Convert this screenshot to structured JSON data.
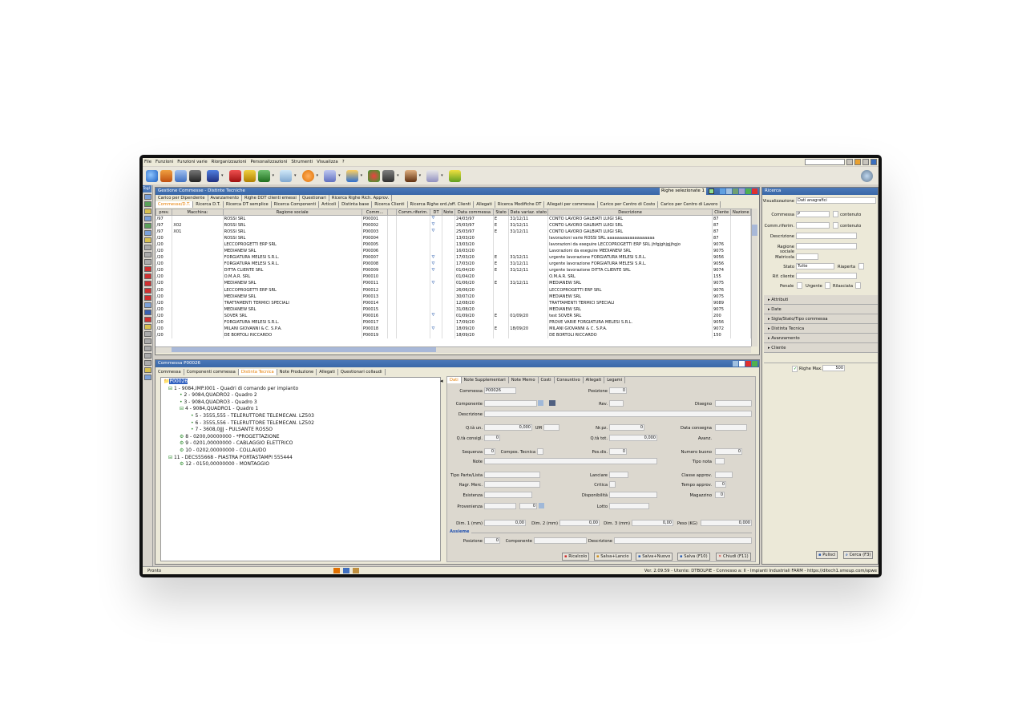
{
  "menu": [
    "File",
    "Funzioni",
    "Funzioni varie",
    "Riorganizzazioni",
    "Personalizzazioni",
    "Strumenti",
    "Visualizza",
    "?"
  ],
  "left_top_tab": "Togl",
  "main": {
    "title": "Gestione Commesse - Distinte Tecniche",
    "selected_label": "Righe selezionate 1",
    "tabs_row1": [
      "Carico per Dipendente",
      "Avanzamento",
      "Righe DDT clienti emessi",
      "Questionari",
      "Ricerca Righe Rich. Approv."
    ],
    "tabs_row2": [
      "Commesse/D.T.",
      "Ricerca D.T.",
      "Ricerca DT semplice",
      "Ricerca Componenti",
      "Articoli",
      "Distinta base",
      "Ricerca Clienti",
      "Ricerca Righe ord./off. Clienti",
      "Allegati",
      "Ricerca Modifiche DT",
      "Allegati per commessa",
      "Carico per Centro di Costo",
      "Carico per Centro di Lavoro"
    ],
    "columns": [
      "prev.",
      "Macchina:",
      "Ragione sociale",
      "Comm...",
      "",
      "Comm.riferim.",
      "DT",
      "Note",
      "Data commessa",
      "Stato",
      "Data variaz. stato",
      "Descrizione",
      "Cliente",
      "Nazione"
    ],
    "rows": [
      [
        "/97",
        "",
        "ROSSI SRL",
        "P00001",
        "",
        "",
        "",
        "",
        "24/03/97",
        "E",
        "31/12/11",
        "CONTO LAVORO GALBIATI LUIGI SRL",
        "87",
        ""
      ],
      [
        "/97",
        "X02",
        "ROSSI SRL",
        "P00002",
        "",
        "",
        "",
        "",
        "25/03/97",
        "E",
        "31/12/11",
        "CONTO LAVORO GALBIATI LUIGI SRL",
        "87",
        ""
      ],
      [
        "/97",
        "X01",
        "ROSSI SRL",
        "P00003",
        "",
        "",
        "",
        "",
        "25/03/97",
        "E",
        "31/12/11",
        "CONTO LAVORO GALBIATI LUIGI SRL",
        "87",
        ""
      ],
      [
        "/20",
        "",
        "ROSSI SRL",
        "P00004",
        "",
        "",
        "",
        "",
        "13/03/20",
        "",
        "",
        "lavorazioni varie ROSSI SRL aaaaaaaaaaaaaaaaaaa",
        "87",
        ""
      ],
      [
        "/20",
        "",
        "LECCOPROGETTI ERP SRL",
        "P00005",
        "",
        "",
        "",
        "",
        "13/03/20",
        "",
        "",
        "lavorazioni da eseguire LECCOPROGETTI ERP SRL jhfgjghjgjjhgjo",
        "9076",
        ""
      ],
      [
        "/20",
        "",
        "MEDIANEW SRL",
        "P00006",
        "",
        "",
        "",
        "",
        "16/03/20",
        "",
        "",
        "Lavorazioni da eseguire MEDIANEW SRL",
        "9075",
        ""
      ],
      [
        "/20",
        "",
        "FORGIATURA MELESI S.R.L.",
        "P00007",
        "",
        "",
        "",
        "",
        "17/03/20",
        "E",
        "31/12/11",
        "urgente lavorazione FORGIATURA MELESI S.R.L.",
        "9056",
        ""
      ],
      [
        "/20",
        "",
        "FORGIATURA MELESI S.R.L.",
        "P00008",
        "",
        "",
        "",
        "",
        "17/03/20",
        "E",
        "31/12/11",
        "urgente lavorazione FORGIATURA MELESI S.R.L.",
        "9056",
        ""
      ],
      [
        "/20",
        "",
        "DITTA CLIENTE SRL",
        "P00009",
        "",
        "",
        "",
        "",
        "01/04/20",
        "E",
        "31/12/11",
        "urgente lavorazione DITTA CLIENTE SRL",
        "9074",
        ""
      ],
      [
        "/20",
        "",
        "O.M.A.R. SRL",
        "P00010",
        "",
        "",
        "",
        "",
        "01/04/20",
        "",
        "",
        "O.M.A.R. SRL",
        "155",
        ""
      ],
      [
        "/20",
        "",
        "MEDIANEW SRL",
        "P00011",
        "",
        "",
        "",
        "",
        "01/06/20",
        "E",
        "31/12/11",
        "MEDIANEW SRL",
        "9075",
        ""
      ],
      [
        "/20",
        "",
        "LECCOPROGETTI ERP SRL",
        "P00012",
        "",
        "",
        "",
        "",
        "26/06/20",
        "",
        "",
        "LECCOPROGETTI ERP SRL",
        "9076",
        ""
      ],
      [
        "/20",
        "",
        "MEDIANEW SRL",
        "P00013",
        "",
        "",
        "",
        "",
        "30/07/20",
        "",
        "",
        "MEDIANEW SRL",
        "9075",
        ""
      ],
      [
        "/20",
        "",
        "TRATTAMENTI TERMICI SPECIALI",
        "P00014",
        "",
        "",
        "",
        "",
        "12/08/20",
        "",
        "",
        "TRATTAMENTI TERMICI SPECIALI",
        "9089",
        ""
      ],
      [
        "/20",
        "",
        "MEDIANEW SRL",
        "P00015",
        "",
        "",
        "",
        "",
        "31/08/20",
        "",
        "",
        "MEDIANEW SRL",
        "9075",
        ""
      ],
      [
        "/20",
        "",
        "SOVER SRL",
        "P00016",
        "",
        "",
        "",
        "",
        "01/09/20",
        "E",
        "01/09/20",
        "test SOVER SRL",
        "200",
        ""
      ],
      [
        "/20",
        "",
        "FORGIATURA MELESI S.R.L.",
        "P00017",
        "",
        "",
        "",
        "",
        "17/09/20",
        "",
        "",
        "PROVE VARIE FORGIATURA MELESI S.R.L.",
        "9056",
        ""
      ],
      [
        "/20",
        "",
        "MILANI GIOVANNI & C. S.P.A.",
        "P00018",
        "",
        "",
        "",
        "",
        "18/09/20",
        "E",
        "18/09/20",
        "MILANI GIOVANNI & C. S.P.A.",
        "9072",
        ""
      ],
      [
        "/20",
        "",
        "DE BORTOLI RICCARDO",
        "P00019",
        "",
        "",
        "",
        "",
        "18/09/20",
        "",
        "",
        "DE BORTOLI RICCARDO",
        "150",
        ""
      ]
    ]
  },
  "detail": {
    "title": "Commessa P00026",
    "tabs": [
      "Commessa",
      "Componenti commessa",
      "Distinta Tecnica",
      "Note Produzione",
      "Allegati",
      "Questionari collaudi"
    ],
    "tree": [
      "P00026",
      "1 - 9084,IMP.I001 - Quadri di comando per impianto",
      "2 - 9084,QUADRO2 - Quadro 2",
      "3 - 9084,QUADRO3 - Quadro 3",
      "4 - 9084,QUADRO1 - Quadro 1",
      "5 - 3555,555 - TELERUTTORE TELEMECAN. LZ503",
      "6 - 3555,556 - TELERUTTORE TELEMECAN. LZ502",
      "7 - 3608,0JJJ - PULSANTE ROSSO",
      "8 - 0200,00000000 - *PROGETTAZIONE",
      "9 - 0201,00000000 - CABLAGGIO ELETTRICO",
      "10 - 0202,00000000 - COLLAUDO",
      "11 - DECS55668 - PIASTRA PORTASTAMPI 555444",
      "12 - 0150,00000000 - MONTAGGIO"
    ],
    "form_tabs": [
      "Dati",
      "Note Supplementari",
      "Note Memo",
      "Costi",
      "Consuntivo",
      "Allegati",
      "Legami"
    ],
    "labels": {
      "commessa": "Commessa",
      "posizione": "Posizione",
      "componente": "Componente",
      "rev": "Rev.",
      "disegno": "Disegno",
      "descrizione": "Descrizione",
      "qta_un": "Q.tà un.",
      "um": "UM",
      "nrpz": "Nr.pz.",
      "data_consegna": "Data consegna",
      "qta_consigl": "Q.tà consigl.",
      "qta_tot": "Q.tà tot.",
      "avanz": "Avanz.",
      "sequenza": "Sequenza",
      "compos": "Compos. Tecnica",
      "posdis": "Pos.dis.",
      "numero_buono": "Numero buono",
      "note": "Note",
      "tipo_nota": "Tipo nota",
      "tipo_parte": "Tipo Parte/Lista",
      "lanciare": "Lanciare",
      "classe_approv": "Classe approv.",
      "ragr_merc": "Ragr. Merc.",
      "critica": "Critica",
      "tempo_approv": "Tempo approv.",
      "esistenza": "Esistenza",
      "disponibilita": "Disponibilità",
      "magazzino": "Magazzino",
      "provenienza": "Provenienza",
      "lotto": "Lotto",
      "dim1": "Dim. 1 (mm)",
      "dim2": "Dim. 2 (mm)",
      "dim3": "Dim. 3 (mm)",
      "peso": "Peso (KG)",
      "assieme": "Assieme",
      "a_posizione": "Posizione",
      "a_componente": "Componente",
      "a_descrizione": "Descrizione"
    },
    "values": {
      "commessa": "P00026",
      "posizione": "0",
      "qta_un": "0,000",
      "nrpz": "0",
      "qta_consigl": "0",
      "qta_tot": "0,000",
      "sequenza": "0",
      "posdis": "0",
      "numero_buono": "0",
      "tempo_approv": "0",
      "magazzino": "0",
      "provenienza": "0",
      "dim1": "0,00",
      "dim2": "0,00",
      "dim3": "0,00",
      "peso": "0,000",
      "a_posizione": "0"
    },
    "buttons": [
      "Ricalcolo",
      "Salva+Lancio",
      "Salva+Nuovo",
      "Salva (F10)",
      "Chiudi (F11)"
    ]
  },
  "search": {
    "title": "Ricerca",
    "visualizzazione_label": "Visualizzazione",
    "visualizzazione": "Dati anagrafici",
    "commessa_label": "Commessa",
    "commessa": "P",
    "contenuto": "contenuto",
    "commrif_label": "Comm.riferim.",
    "descrizione_label": "Descrizione",
    "ragione_label": "Ragione sociale",
    "matricola_label": "Matricola",
    "stato_label": "Stato",
    "stato": "Tutte",
    "riaperta": "Riaperta",
    "rif_cliente": "Rif. cliente",
    "penale": "Penale",
    "urgente": "Urgente",
    "rilasciata": "Rilasciata",
    "sections": [
      "Attributi",
      "Date",
      "Sigla/Stato/Tipo commessa",
      "Distinta Tecnica",
      "Avanzamento",
      "Cliente"
    ],
    "righe_max_label": "Righe Max.",
    "righe_max": "500",
    "pulisci": "Pulisci",
    "cerca": "Cerca (F3)"
  },
  "status": {
    "left": "Pronto",
    "right": "Ver. 2.09.59 - Utente: DTBOLPIE - Connesso a: II - Impianti Industriali FARM - https://ditech1.smeup.com/spwe"
  }
}
